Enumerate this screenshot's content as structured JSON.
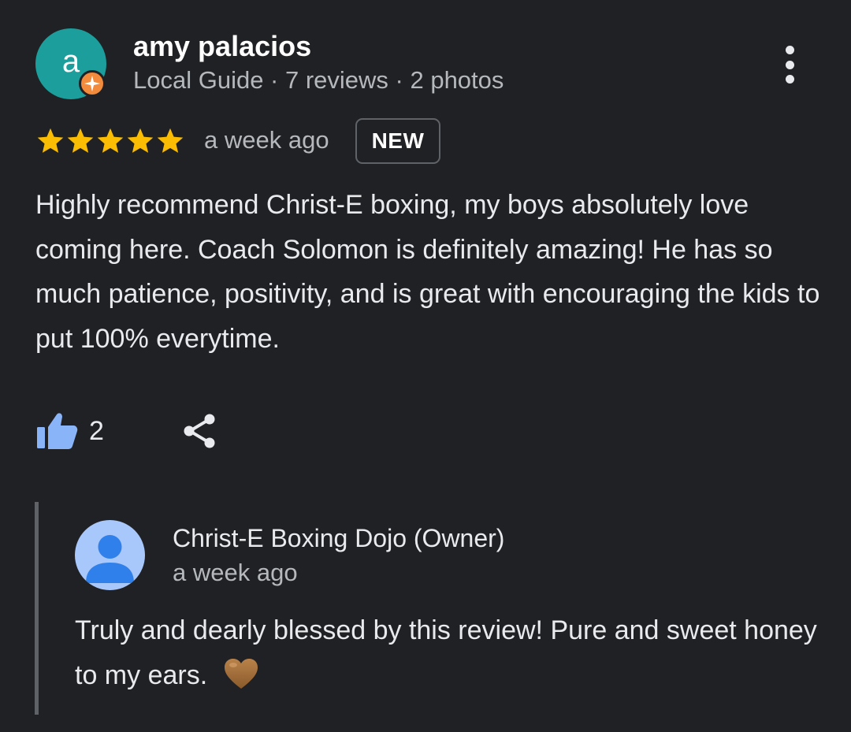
{
  "reviewer": {
    "avatar_letter": "a",
    "avatar_color": "#1b9e9c",
    "badge_icon": "local-guide-badge-icon",
    "badge_color": "#f28b3b",
    "name": "amy palacios",
    "meta": "Local Guide · 7 reviews · 2 photos"
  },
  "menu": {
    "icon": "more-vertical-icon"
  },
  "review": {
    "rating": 5,
    "rating_max": 5,
    "star_color": "#fbbc04",
    "time": "a week ago",
    "badge": "NEW",
    "text": "Highly recommend Christ-E boxing, my boys absolutely love coming here. Coach Solomon is definitely amazing! He has so much patience, positivity, and is great with encouraging the kids to put 100% everytime."
  },
  "actions": {
    "like_icon": "thumbs-up-icon",
    "like_color": "#8ab4f8",
    "like_count": "2",
    "share_icon": "share-icon"
  },
  "owner_reply": {
    "avatar_icon": "person-avatar-icon",
    "name": "Christ-E Boxing Dojo (Owner)",
    "time": "a week ago",
    "text": "Truly and dearly blessed by this review! Pure and sweet honey to my ears.",
    "emoji_icon": "brown-heart-icon"
  }
}
